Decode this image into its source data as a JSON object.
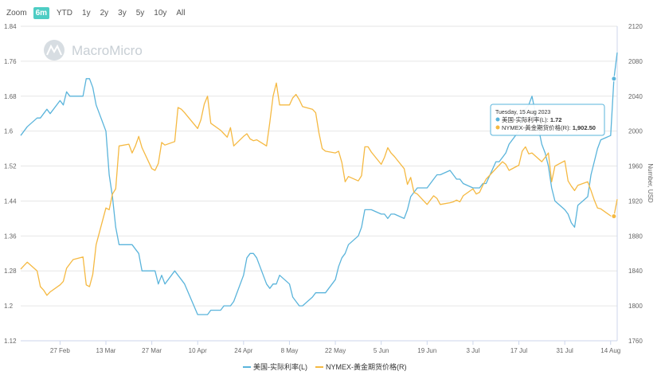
{
  "toolbar": {
    "zoom_label": "Zoom",
    "range_buttons": [
      "6m",
      "YTD",
      "1y",
      "2y",
      "3y",
      "5y",
      "10y",
      "All"
    ],
    "active": "6m"
  },
  "watermark": "MacroMicro",
  "chart_data": {
    "type": "line",
    "x_ticks": [
      "27 Feb",
      "13 Mar",
      "27 Mar",
      "10 Apr",
      "24 Apr",
      "8 May",
      "22 May",
      "5 Jun",
      "19 Jun",
      "3 Jul",
      "17 Jul",
      "31 Jul",
      "14 Aug"
    ],
    "y_left": {
      "ticks": [
        "1.84",
        "1.76",
        "1.68",
        "1.6",
        "1.52",
        "1.44",
        "1.36",
        "1.28",
        "1.2",
        "1.12"
      ],
      "range": [
        1.12,
        1.84
      ]
    },
    "y_right": {
      "label": "Number, USD",
      "ticks": [
        "2120",
        "2080",
        "2040",
        "2000",
        "1960",
        "1920",
        "1880",
        "1840",
        "1800",
        "1760"
      ],
      "range": [
        1760,
        2120
      ]
    },
    "series": [
      {
        "name": "美国-实际利率(L)",
        "axis": "left",
        "color": "#5ab4db",
        "points": [
          [
            "2023-02-15",
            1.59
          ],
          [
            "2023-02-16",
            1.6
          ],
          [
            "2023-02-17",
            1.61
          ],
          [
            "2023-02-20",
            1.63
          ],
          [
            "2023-02-21",
            1.63
          ],
          [
            "2023-02-22",
            1.64
          ],
          [
            "2023-02-23",
            1.65
          ],
          [
            "2023-02-24",
            1.64
          ],
          [
            "2023-02-27",
            1.67
          ],
          [
            "2023-02-28",
            1.66
          ],
          [
            "2023-03-01",
            1.69
          ],
          [
            "2023-03-02",
            1.68
          ],
          [
            "2023-03-03",
            1.68
          ],
          [
            "2023-03-06",
            1.68
          ],
          [
            "2023-03-07",
            1.72
          ],
          [
            "2023-03-08",
            1.72
          ],
          [
            "2023-03-09",
            1.7
          ],
          [
            "2023-03-10",
            1.66
          ],
          [
            "2023-03-13",
            1.6
          ],
          [
            "2023-03-14",
            1.5
          ],
          [
            "2023-03-15",
            1.45
          ],
          [
            "2023-03-16",
            1.38
          ],
          [
            "2023-03-17",
            1.34
          ],
          [
            "2023-03-20",
            1.34
          ],
          [
            "2023-03-21",
            1.34
          ],
          [
            "2023-03-22",
            1.33
          ],
          [
            "2023-03-23",
            1.32
          ],
          [
            "2023-03-24",
            1.28
          ],
          [
            "2023-03-27",
            1.28
          ],
          [
            "2023-03-28",
            1.28
          ],
          [
            "2023-03-29",
            1.25
          ],
          [
            "2023-03-30",
            1.27
          ],
          [
            "2023-03-31",
            1.25
          ],
          [
            "2023-04-03",
            1.28
          ],
          [
            "2023-04-04",
            1.27
          ],
          [
            "2023-04-05",
            1.26
          ],
          [
            "2023-04-06",
            1.25
          ],
          [
            "2023-04-10",
            1.18
          ],
          [
            "2023-04-11",
            1.18
          ],
          [
            "2023-04-12",
            1.18
          ],
          [
            "2023-04-13",
            1.18
          ],
          [
            "2023-04-14",
            1.19
          ],
          [
            "2023-04-17",
            1.19
          ],
          [
            "2023-04-18",
            1.2
          ],
          [
            "2023-04-19",
            1.2
          ],
          [
            "2023-04-20",
            1.2
          ],
          [
            "2023-04-21",
            1.21
          ],
          [
            "2023-04-24",
            1.27
          ],
          [
            "2023-04-25",
            1.31
          ],
          [
            "2023-04-26",
            1.32
          ],
          [
            "2023-04-27",
            1.32
          ],
          [
            "2023-04-28",
            1.31
          ],
          [
            "2023-05-01",
            1.25
          ],
          [
            "2023-05-02",
            1.24
          ],
          [
            "2023-05-03",
            1.25
          ],
          [
            "2023-05-04",
            1.25
          ],
          [
            "2023-05-05",
            1.27
          ],
          [
            "2023-05-08",
            1.25
          ],
          [
            "2023-05-09",
            1.22
          ],
          [
            "2023-05-10",
            1.21
          ],
          [
            "2023-05-11",
            1.2
          ],
          [
            "2023-05-12",
            1.2
          ],
          [
            "2023-05-15",
            1.22
          ],
          [
            "2023-05-16",
            1.23
          ],
          [
            "2023-05-17",
            1.23
          ],
          [
            "2023-05-18",
            1.23
          ],
          [
            "2023-05-19",
            1.23
          ],
          [
            "2023-05-22",
            1.26
          ],
          [
            "2023-05-23",
            1.29
          ],
          [
            "2023-05-24",
            1.31
          ],
          [
            "2023-05-25",
            1.32
          ],
          [
            "2023-05-26",
            1.34
          ],
          [
            "2023-05-29",
            1.36
          ],
          [
            "2023-05-30",
            1.38
          ],
          [
            "2023-05-31",
            1.42
          ],
          [
            "2023-06-01",
            1.42
          ],
          [
            "2023-06-02",
            1.42
          ],
          [
            "2023-06-05",
            1.41
          ],
          [
            "2023-06-06",
            1.41
          ],
          [
            "2023-06-07",
            1.4
          ],
          [
            "2023-06-08",
            1.41
          ],
          [
            "2023-06-09",
            1.41
          ],
          [
            "2023-06-12",
            1.4
          ],
          [
            "2023-06-13",
            1.42
          ],
          [
            "2023-06-14",
            1.45
          ],
          [
            "2023-06-15",
            1.46
          ],
          [
            "2023-06-16",
            1.47
          ],
          [
            "2023-06-19",
            1.47
          ],
          [
            "2023-06-20",
            1.48
          ],
          [
            "2023-06-21",
            1.49
          ],
          [
            "2023-06-22",
            1.5
          ],
          [
            "2023-06-23",
            1.5
          ],
          [
            "2023-06-26",
            1.51
          ],
          [
            "2023-06-27",
            1.5
          ],
          [
            "2023-06-28",
            1.49
          ],
          [
            "2023-06-29",
            1.49
          ],
          [
            "2023-06-30",
            1.48
          ],
          [
            "2023-07-03",
            1.47
          ],
          [
            "2023-07-04",
            1.47
          ],
          [
            "2023-07-05",
            1.47
          ],
          [
            "2023-07-06",
            1.48
          ],
          [
            "2023-07-07",
            1.48
          ],
          [
            "2023-07-10",
            1.53
          ],
          [
            "2023-07-11",
            1.53
          ],
          [
            "2023-07-12",
            1.54
          ],
          [
            "2023-07-13",
            1.55
          ],
          [
            "2023-07-14",
            1.57
          ],
          [
            "2023-07-17",
            1.6
          ],
          [
            "2023-07-18",
            1.63
          ],
          [
            "2023-07-19",
            1.65
          ],
          [
            "2023-07-20",
            1.66
          ],
          [
            "2023-07-21",
            1.68
          ],
          [
            "2023-07-24",
            1.57
          ],
          [
            "2023-07-25",
            1.55
          ],
          [
            "2023-07-26",
            1.52
          ],
          [
            "2023-07-27",
            1.47
          ],
          [
            "2023-07-28",
            1.44
          ],
          [
            "2023-07-31",
            1.42
          ],
          [
            "2023-08-01",
            1.41
          ],
          [
            "2023-08-02",
            1.39
          ],
          [
            "2023-08-03",
            1.38
          ],
          [
            "2023-08-04",
            1.43
          ],
          [
            "2023-08-07",
            1.45
          ],
          [
            "2023-08-08",
            1.5
          ],
          [
            "2023-08-09",
            1.53
          ],
          [
            "2023-08-10",
            1.56
          ],
          [
            "2023-08-11",
            1.58
          ],
          [
            "2023-08-14",
            1.59
          ],
          [
            "2023-08-15",
            1.72
          ],
          [
            "2023-08-16",
            1.78
          ]
        ]
      },
      {
        "name": "NYMEX-黃金期货价格(R)",
        "axis": "right",
        "color": "#f5b942",
        "points": [
          [
            "2023-02-15",
            1842
          ],
          [
            "2023-02-16",
            1846
          ],
          [
            "2023-02-17",
            1850
          ],
          [
            "2023-02-20",
            1840
          ],
          [
            "2023-02-21",
            1822
          ],
          [
            "2023-02-22",
            1818
          ],
          [
            "2023-02-23",
            1812
          ],
          [
            "2023-02-24",
            1816
          ],
          [
            "2023-02-27",
            1824
          ],
          [
            "2023-02-28",
            1828
          ],
          [
            "2023-03-01",
            1843
          ],
          [
            "2023-03-02",
            1848
          ],
          [
            "2023-03-03",
            1853
          ],
          [
            "2023-03-06",
            1856
          ],
          [
            "2023-03-07",
            1824
          ],
          [
            "2023-03-08",
            1822
          ],
          [
            "2023-03-09",
            1836
          ],
          [
            "2023-03-10",
            1870
          ],
          [
            "2023-03-13",
            1912
          ],
          [
            "2023-03-14",
            1910
          ],
          [
            "2023-03-15",
            1928
          ],
          [
            "2023-03-16",
            1934
          ],
          [
            "2023-03-17",
            1983
          ],
          [
            "2023-03-20",
            1985
          ],
          [
            "2023-03-21",
            1975
          ],
          [
            "2023-03-22",
            1983
          ],
          [
            "2023-03-23",
            1994
          ],
          [
            "2023-03-24",
            1981
          ],
          [
            "2023-03-27",
            1957
          ],
          [
            "2023-03-28",
            1955
          ],
          [
            "2023-03-29",
            1963
          ],
          [
            "2023-03-30",
            1987
          ],
          [
            "2023-03-31",
            1984
          ],
          [
            "2023-04-03",
            1988
          ],
          [
            "2023-04-04",
            2027
          ],
          [
            "2023-04-05",
            2025
          ],
          [
            "2023-04-06",
            2021
          ],
          [
            "2023-04-10",
            2003
          ],
          [
            "2023-04-11",
            2013
          ],
          [
            "2023-04-12",
            2031
          ],
          [
            "2023-04-13",
            2040
          ],
          [
            "2023-04-14",
            2009
          ],
          [
            "2023-04-17",
            2001
          ],
          [
            "2023-04-18",
            1997
          ],
          [
            "2023-04-19",
            1993
          ],
          [
            "2023-04-20",
            2004
          ],
          [
            "2023-04-21",
            1983
          ],
          [
            "2023-04-24",
            1994
          ],
          [
            "2023-04-25",
            1997
          ],
          [
            "2023-04-26",
            1991
          ],
          [
            "2023-04-27",
            1989
          ],
          [
            "2023-04-28",
            1990
          ],
          [
            "2023-05-01",
            1983
          ],
          [
            "2023-05-02",
            2010
          ],
          [
            "2023-05-03",
            2040
          ],
          [
            "2023-05-04",
            2055
          ],
          [
            "2023-05-05",
            2030
          ],
          [
            "2023-05-08",
            2030
          ],
          [
            "2023-05-09",
            2038
          ],
          [
            "2023-05-10",
            2042
          ],
          [
            "2023-05-11",
            2036
          ],
          [
            "2023-05-12",
            2028
          ],
          [
            "2023-05-15",
            2025
          ],
          [
            "2023-05-16",
            2021
          ],
          [
            "2023-05-17",
            1998
          ],
          [
            "2023-05-18",
            1980
          ],
          [
            "2023-05-19",
            1977
          ],
          [
            "2023-05-22",
            1975
          ],
          [
            "2023-05-23",
            1977
          ],
          [
            "2023-05-24",
            1964
          ],
          [
            "2023-05-25",
            1942
          ],
          [
            "2023-05-26",
            1948
          ],
          [
            "2023-05-29",
            1943
          ],
          [
            "2023-05-30",
            1949
          ],
          [
            "2023-05-31",
            1982
          ],
          [
            "2023-06-01",
            1982
          ],
          [
            "2023-06-02",
            1976
          ],
          [
            "2023-06-05",
            1962
          ],
          [
            "2023-06-06",
            1970
          ],
          [
            "2023-06-07",
            1981
          ],
          [
            "2023-06-08",
            1975
          ],
          [
            "2023-06-09",
            1971
          ],
          [
            "2023-06-12",
            1957
          ],
          [
            "2023-06-13",
            1939
          ],
          [
            "2023-06-14",
            1947
          ],
          [
            "2023-06-15",
            1930
          ],
          [
            "2023-06-16",
            1928
          ],
          [
            "2023-06-19",
            1916
          ],
          [
            "2023-06-20",
            1921
          ],
          [
            "2023-06-21",
            1926
          ],
          [
            "2023-06-22",
            1923
          ],
          [
            "2023-06-23",
            1916
          ],
          [
            "2023-06-26",
            1918
          ],
          [
            "2023-06-27",
            1919
          ],
          [
            "2023-06-28",
            1921
          ],
          [
            "2023-06-29",
            1919
          ],
          [
            "2023-06-30",
            1926
          ],
          [
            "2023-07-03",
            1934
          ],
          [
            "2023-07-04",
            1928
          ],
          [
            "2023-07-05",
            1930
          ],
          [
            "2023-07-06",
            1938
          ],
          [
            "2023-07-07",
            1945
          ],
          [
            "2023-07-10",
            1957
          ],
          [
            "2023-07-11",
            1961
          ],
          [
            "2023-07-12",
            1965
          ],
          [
            "2023-07-13",
            1962
          ],
          [
            "2023-07-14",
            1955
          ],
          [
            "2023-07-17",
            1961
          ],
          [
            "2023-07-18",
            1977
          ],
          [
            "2023-07-19",
            1982
          ],
          [
            "2023-07-20",
            1974
          ],
          [
            "2023-07-21",
            1975
          ],
          [
            "2023-07-24",
            1965
          ],
          [
            "2023-07-25",
            1970
          ],
          [
            "2023-07-26",
            1975
          ],
          [
            "2023-07-27",
            1942
          ],
          [
            "2023-07-28",
            1960
          ],
          [
            "2023-07-31",
            1966
          ],
          [
            "2023-08-01",
            1943
          ],
          [
            "2023-08-02",
            1937
          ],
          [
            "2023-08-03",
            1932
          ],
          [
            "2023-08-04",
            1938
          ],
          [
            "2023-08-07",
            1942
          ],
          [
            "2023-08-08",
            1932
          ],
          [
            "2023-08-09",
            1921
          ],
          [
            "2023-08-10",
            1912
          ],
          [
            "2023-08-11",
            1911
          ],
          [
            "2023-08-14",
            1903
          ],
          [
            "2023-08-15",
            1902.5
          ],
          [
            "2023-08-16",
            1922
          ]
        ]
      }
    ],
    "tooltip": {
      "date": "Tuesday, 15 Aug 2023",
      "rows": [
        {
          "label": "美国-实际利率(L): ",
          "value": "1.72",
          "color": "#5ab4db"
        },
        {
          "label": "NYMEX-黃金期货价格(R): ",
          "value": "1,902.50",
          "color": "#f5b942"
        }
      ]
    }
  }
}
